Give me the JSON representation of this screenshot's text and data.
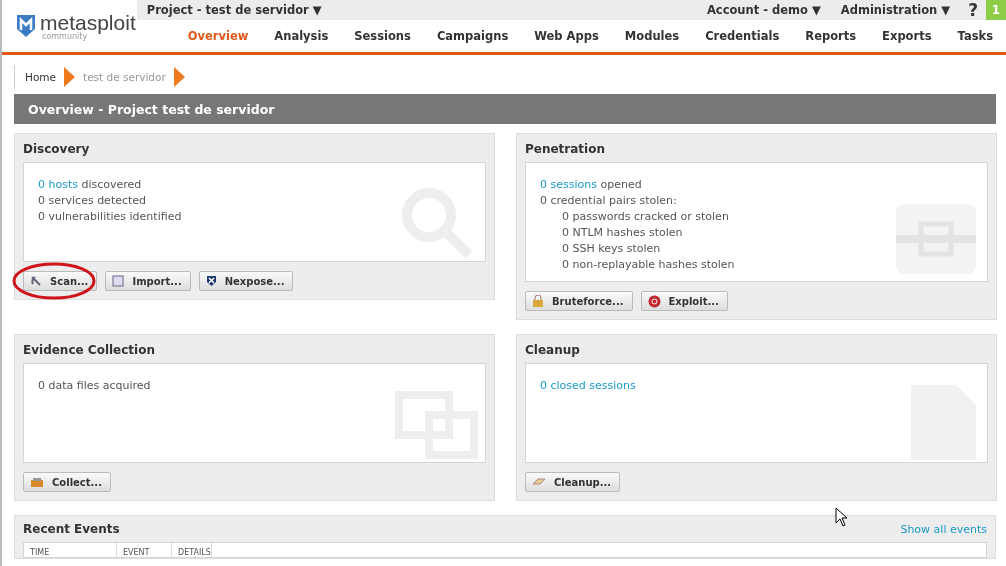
{
  "header": {
    "logo": {
      "name": "metasploit",
      "edition": "community"
    },
    "project_menu": "Project - test de servidor ▼",
    "account_menu": "Account - demo ▼",
    "admin_menu": "Administration ▼",
    "help": "?",
    "notification_count": "1"
  },
  "nav": [
    {
      "label": "Overview",
      "selected": true
    },
    {
      "label": "Analysis",
      "selected": false
    },
    {
      "label": "Sessions",
      "selected": false
    },
    {
      "label": "Campaigns",
      "selected": false
    },
    {
      "label": "Web Apps",
      "selected": false
    },
    {
      "label": "Modules",
      "selected": false
    },
    {
      "label": "Credentials",
      "selected": false
    },
    {
      "label": "Reports",
      "selected": false
    },
    {
      "label": "Exports",
      "selected": false
    },
    {
      "label": "Tasks",
      "selected": false
    }
  ],
  "breadcrumb": [
    "Home",
    "test de servidor"
  ],
  "page_title": "Overview - Project test de servidor",
  "panels": [
    {
      "title": "Discovery",
      "lines": [
        {
          "link": "0 hosts",
          "text": " discovered"
        },
        {
          "text": "0 services detected"
        },
        {
          "text": "0 vulnerabilities identified"
        }
      ],
      "buttons": [
        {
          "label": "Scan...",
          "highlighted": true
        },
        {
          "label": "Import...",
          "highlighted": false
        },
        {
          "label": "Nexpose...",
          "highlighted": false
        }
      ]
    },
    {
      "title": "Penetration",
      "lines": [
        {
          "link": "0 sessions",
          "text": " opened"
        },
        {
          "text": "0 credential pairs stolen:",
          "children": [
            {
              "text": "0 passwords cracked or stolen"
            },
            {
              "text": "0 NTLM hashes stolen"
            },
            {
              "text": "0 SSH keys stolen"
            },
            {
              "text": "0 non-replayable hashes stolen"
            }
          ]
        }
      ],
      "buttons": [
        {
          "label": "Bruteforce...",
          "highlighted": false
        },
        {
          "label": "Exploit...",
          "highlighted": false
        }
      ]
    },
    {
      "title": "Evidence Collection",
      "lines": [
        {
          "text": "0 data files acquired"
        }
      ],
      "buttons": [
        {
          "label": "Collect...",
          "highlighted": false
        }
      ]
    },
    {
      "title": "Cleanup",
      "lines": [
        {
          "link": "0 closed sessions"
        }
      ],
      "buttons": [
        {
          "label": "Cleanup...",
          "highlighted": false
        }
      ]
    }
  ],
  "recent_events": {
    "title": "Recent Events",
    "link": "Show all events",
    "columns": [
      "TIME",
      "EVENT",
      "DETAILS"
    ]
  }
}
